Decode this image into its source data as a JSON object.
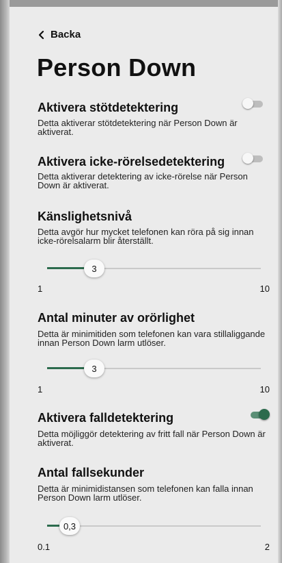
{
  "nav": {
    "back_label": "Backa"
  },
  "page": {
    "title": "Person Down"
  },
  "settings": [
    {
      "title": "Aktivera stötdetektering",
      "desc": "Detta aktiverar stötdetektering när Person Down är aktiverat.",
      "enabled": false
    },
    {
      "title": "Aktivera icke-rörelsedetektering",
      "desc": "Detta aktiverar detektering av icke-rörelse när Person Down är aktiverat.",
      "enabled": false
    },
    {
      "title": "Aktivera falldetektering",
      "desc": "Detta möjliggör detektering av fritt fall när Person Down är aktiverat.",
      "enabled": true
    }
  ],
  "sliders": [
    {
      "title": "Känslighetsnivå",
      "desc": "Detta avgör hur mycket telefonen kan röra på sig innan icke-rörelsalarm blir återställt.",
      "value": "3",
      "min": "1",
      "max": "10",
      "fraction": 0.22
    },
    {
      "title": "Antal minuter av orörlighet",
      "desc": "Detta är minimitiden som telefonen kan vara stillaliggande innan Person Down larm utlöser.",
      "value": "3",
      "min": "1",
      "max": "10",
      "fraction": 0.22
    },
    {
      "title": "Antal fallsekunder",
      "desc": "Detta är minimidistansen som telefonen kan falla innan Person Down larm utlöser.",
      "value": "0,3",
      "min": "0.1",
      "max": "2",
      "fraction": 0.105
    }
  ],
  "colors": {
    "accent": "#2c6b4d",
    "background": "#ebebeb"
  }
}
